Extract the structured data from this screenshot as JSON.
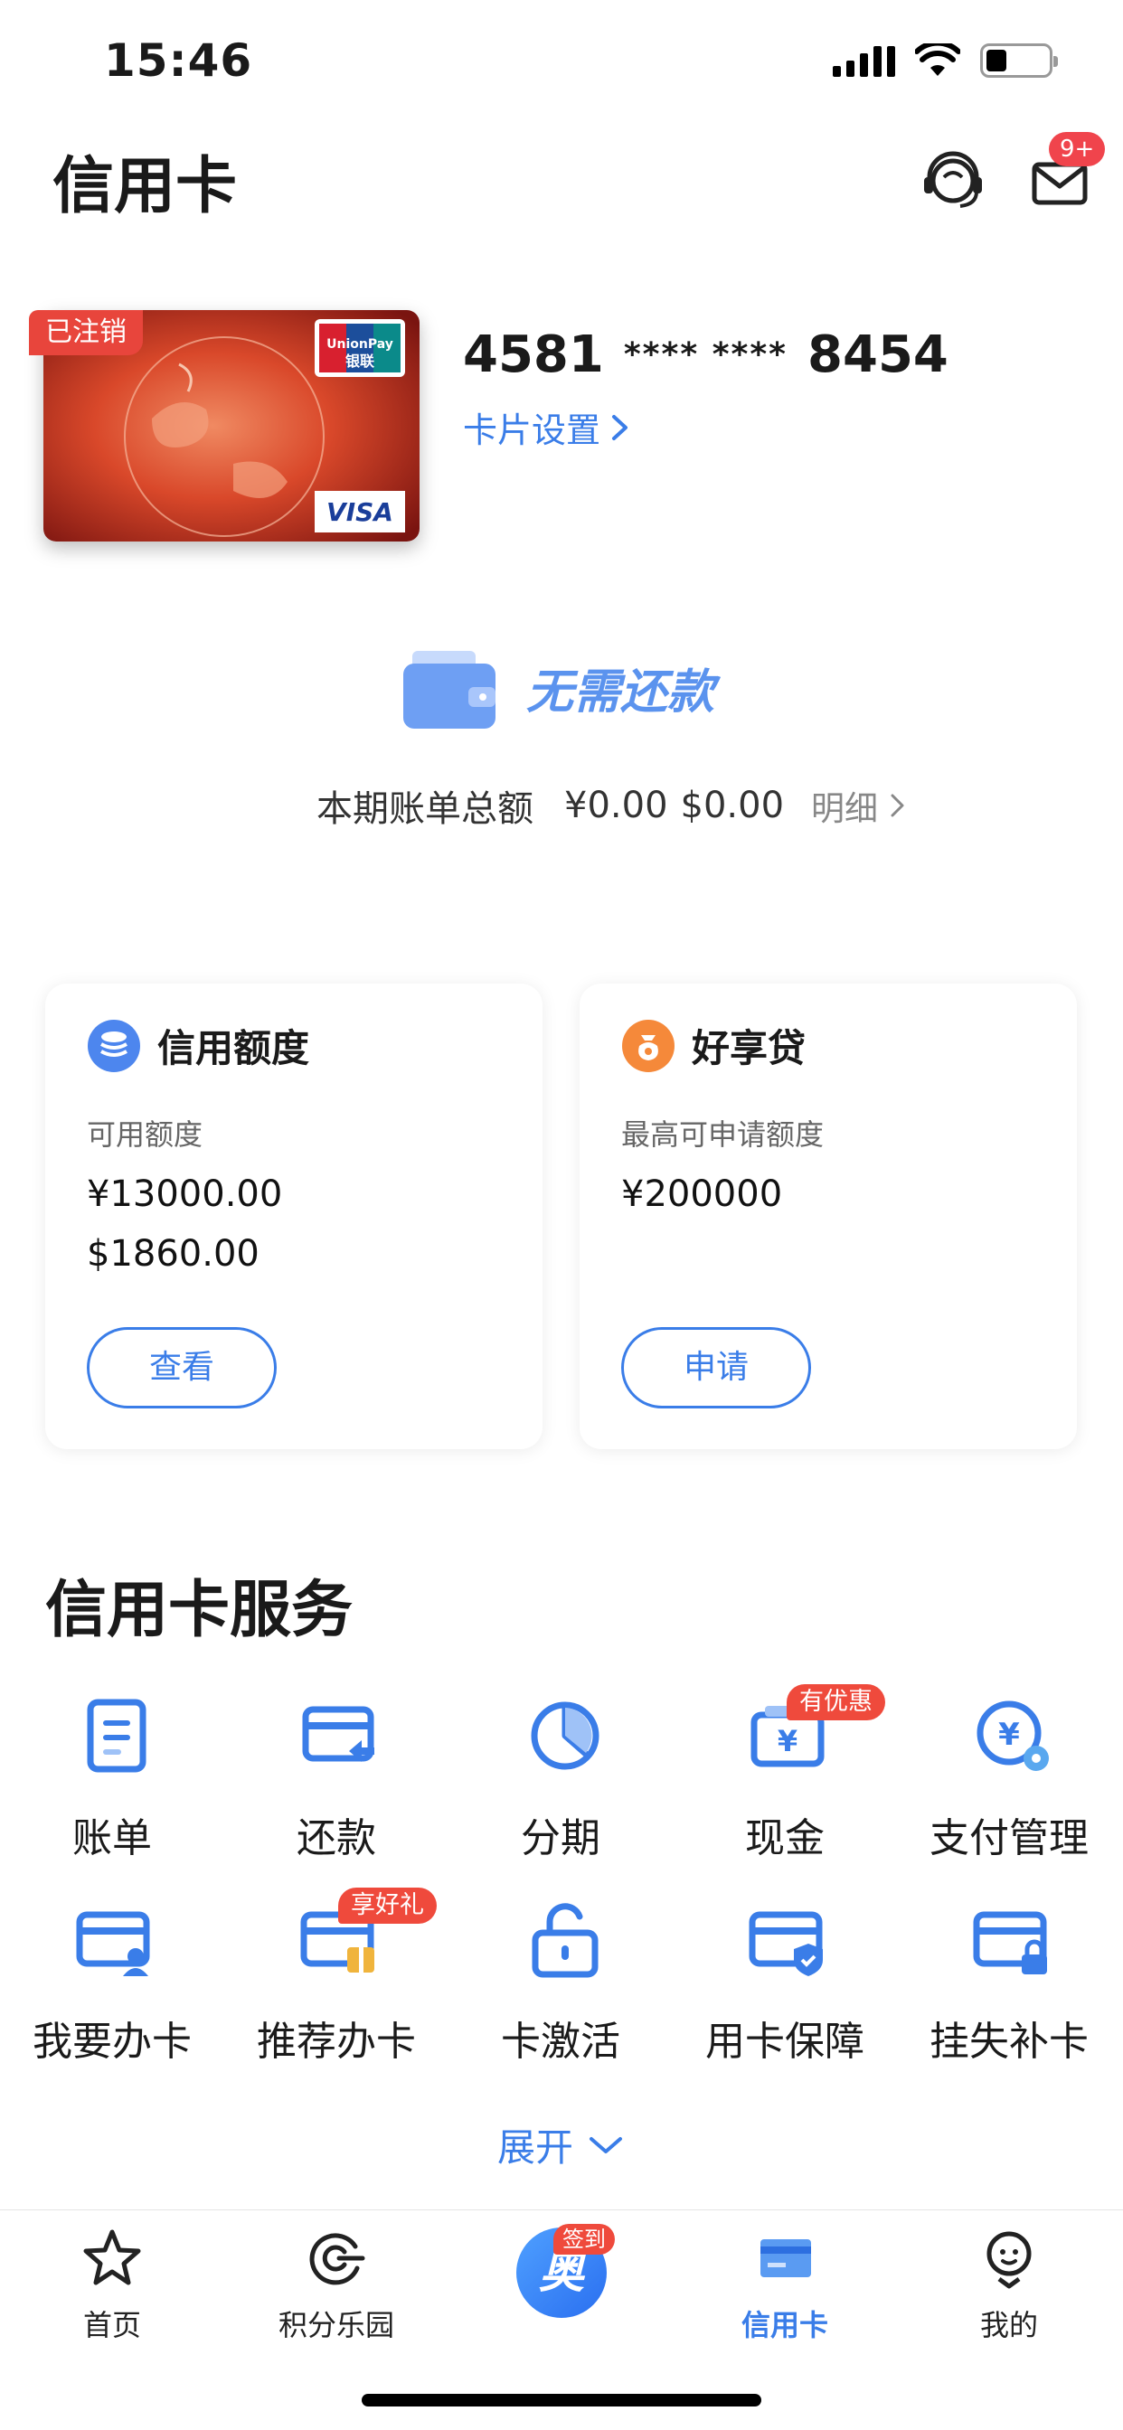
{
  "status_bar": {
    "time": "15:46"
  },
  "header": {
    "title": "信用卡",
    "mail_badge": "9+"
  },
  "card": {
    "status_badge": "已注销",
    "number_prefix": "4581",
    "number_mask": "**** ****",
    "number_suffix": "8454",
    "settings_label": "卡片设置",
    "brand_unionpay": "UnionPay",
    "brand_yinlian": "银联",
    "brand_visa": "VISA"
  },
  "payment": {
    "status": "无需还款",
    "bill_label": "本期账单总额",
    "amount_cny": "¥0.00",
    "amount_usd": "$0.00",
    "detail_label": "明细"
  },
  "credit_limit": {
    "title": "信用额度",
    "subtitle": "可用额度",
    "cny": "¥13000.00",
    "usd": "$1860.00",
    "button": "查看"
  },
  "loan": {
    "title": "好享贷",
    "subtitle": "最高可申请额度",
    "amount": "¥200000",
    "button": "申请"
  },
  "services": {
    "title": "信用卡服务",
    "items": [
      {
        "label": "账单",
        "icon": "bill-icon",
        "tag": ""
      },
      {
        "label": "还款",
        "icon": "repay-icon",
        "tag": ""
      },
      {
        "label": "分期",
        "icon": "installment-icon",
        "tag": ""
      },
      {
        "label": "现金",
        "icon": "cash-icon",
        "tag": "有优惠"
      },
      {
        "label": "支付管理",
        "icon": "payment-manage-icon",
        "tag": ""
      },
      {
        "label": "我要办卡",
        "icon": "apply-card-icon",
        "tag": ""
      },
      {
        "label": "推荐办卡",
        "icon": "recommend-card-icon",
        "tag": "享好礼"
      },
      {
        "label": "卡激活",
        "icon": "unlock-icon",
        "tag": ""
      },
      {
        "label": "用卡保障",
        "icon": "card-protect-icon",
        "tag": ""
      },
      {
        "label": "挂失补卡",
        "icon": "card-lock-icon",
        "tag": ""
      }
    ],
    "expand_label": "展开"
  },
  "tabbar": {
    "items": [
      {
        "label": "首页",
        "icon": "star-icon"
      },
      {
        "label": "积分乐园",
        "icon": "points-icon"
      },
      {
        "label": "",
        "icon": "checkin-icon"
      },
      {
        "label": "信用卡",
        "icon": "credit-card-icon"
      },
      {
        "label": "我的",
        "icon": "profile-icon"
      }
    ],
    "center_badge": "签到",
    "center_glyph": "奥",
    "active": "信用卡"
  },
  "colors": {
    "accent": "#3a7de8",
    "badge_red": "#ef4a3c",
    "loan_orange": "#f5893a"
  }
}
